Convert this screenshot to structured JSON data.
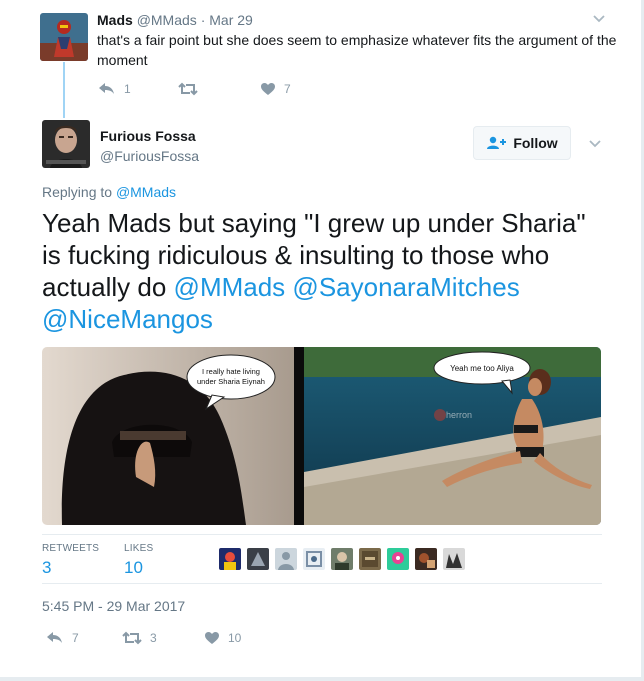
{
  "parent_tweet": {
    "name": "Mads",
    "handle": "@MMads",
    "separator": "·",
    "date": "Mar 29",
    "text": "that's a fair point but she does seem to emphasize whatever fits the argument of the moment",
    "reply_count": "1",
    "retweet_count": "",
    "like_count": "7"
  },
  "main_tweet": {
    "name": "Furious Fossa",
    "handle": "@FuriousFossa",
    "follow_label": "Follow",
    "replying_prefix": "Replying to",
    "replying_to": "@MMads",
    "text": "Yeah Mads but saying \"I grew up under Sharia\" is fucking ridiculous & insulting to those who actually do",
    "mentions": [
      "@MMads",
      "@SayonaraMitches",
      "@NiceMangos"
    ],
    "media": {
      "left_bubble": "I really hate living under Sharia Eiynah",
      "right_bubble": "Yeah me too Aliya",
      "watermark": "herron"
    },
    "stats": {
      "retweets_label": "RETWEETS",
      "retweets": "3",
      "likes_label": "LIKES",
      "likes": "10"
    },
    "timestamp": "5:45 PM - 29 Mar 2017",
    "actions": {
      "reply_count": "7",
      "retweet_count": "3",
      "like_count": "10"
    }
  },
  "colors": {
    "link": "#1b95e0",
    "muted": "#657786",
    "icon": "#8899a6",
    "thread_line": "#a0d4f5"
  }
}
